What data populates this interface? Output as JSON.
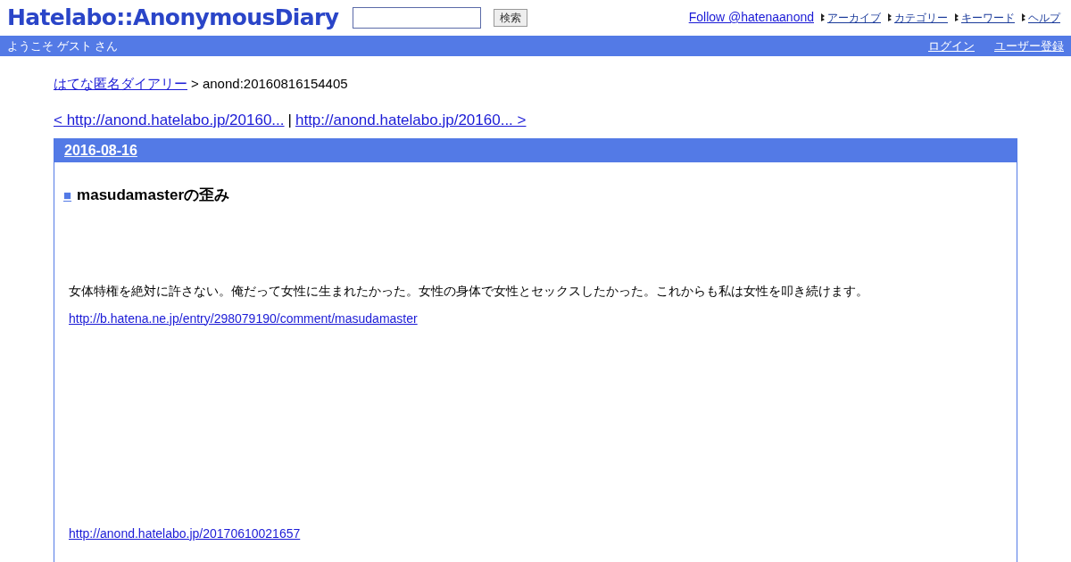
{
  "header": {
    "logo": "Hatelabo::AnonymousDiary",
    "search_button": "検索",
    "follow_link": "Follow @hatenaanond",
    "nav": [
      "アーカイブ",
      "カテゴリー",
      "キーワード",
      "ヘルプ"
    ]
  },
  "welcome_bar": {
    "greeting": "ようこそ ゲスト さん",
    "links": [
      "ログイン",
      "ユーザー登録"
    ]
  },
  "breadcrumb": {
    "link": "はてな匿名ダイアリー",
    "current": "> anond:20160816154405"
  },
  "pager": {
    "prev": "< http://anond.hatelabo.jp/20160...",
    "separator": "|",
    "next": "http://anond.hatelabo.jp/20160... >"
  },
  "entry": {
    "date": "2016-08-16",
    "marker": "■",
    "title": "masudamasterの歪み",
    "body": "女体特権を絶対に許さない。俺だって女性に生まれたかった。女性の身体で女性とセックスしたかった。これからも私は女性を叩き続けます。",
    "link": "http://b.hatena.ne.jp/entry/298079190/comment/masudamaster",
    "footer_link": "http://anond.hatelabo.jp/20170610021657"
  }
}
